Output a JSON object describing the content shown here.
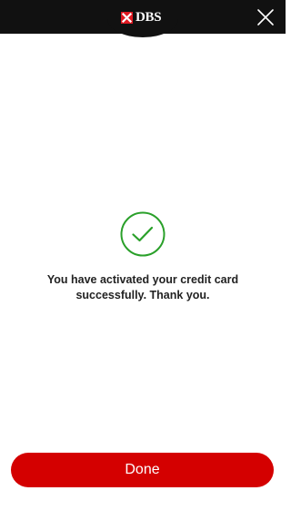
{
  "header": {
    "logo_text": "DBS",
    "logo_icon": "dbs-logo-icon",
    "close_icon": "close-icon",
    "background_color": "#111111",
    "brand_color": "#e01a22"
  },
  "main": {
    "success_icon": "check-circle-icon",
    "success_color": "#2aa02a",
    "message": "You have activated your credit card\nsuccessfully. Thank you."
  },
  "footer": {
    "done_label": "Done",
    "button_color": "#d40000"
  }
}
